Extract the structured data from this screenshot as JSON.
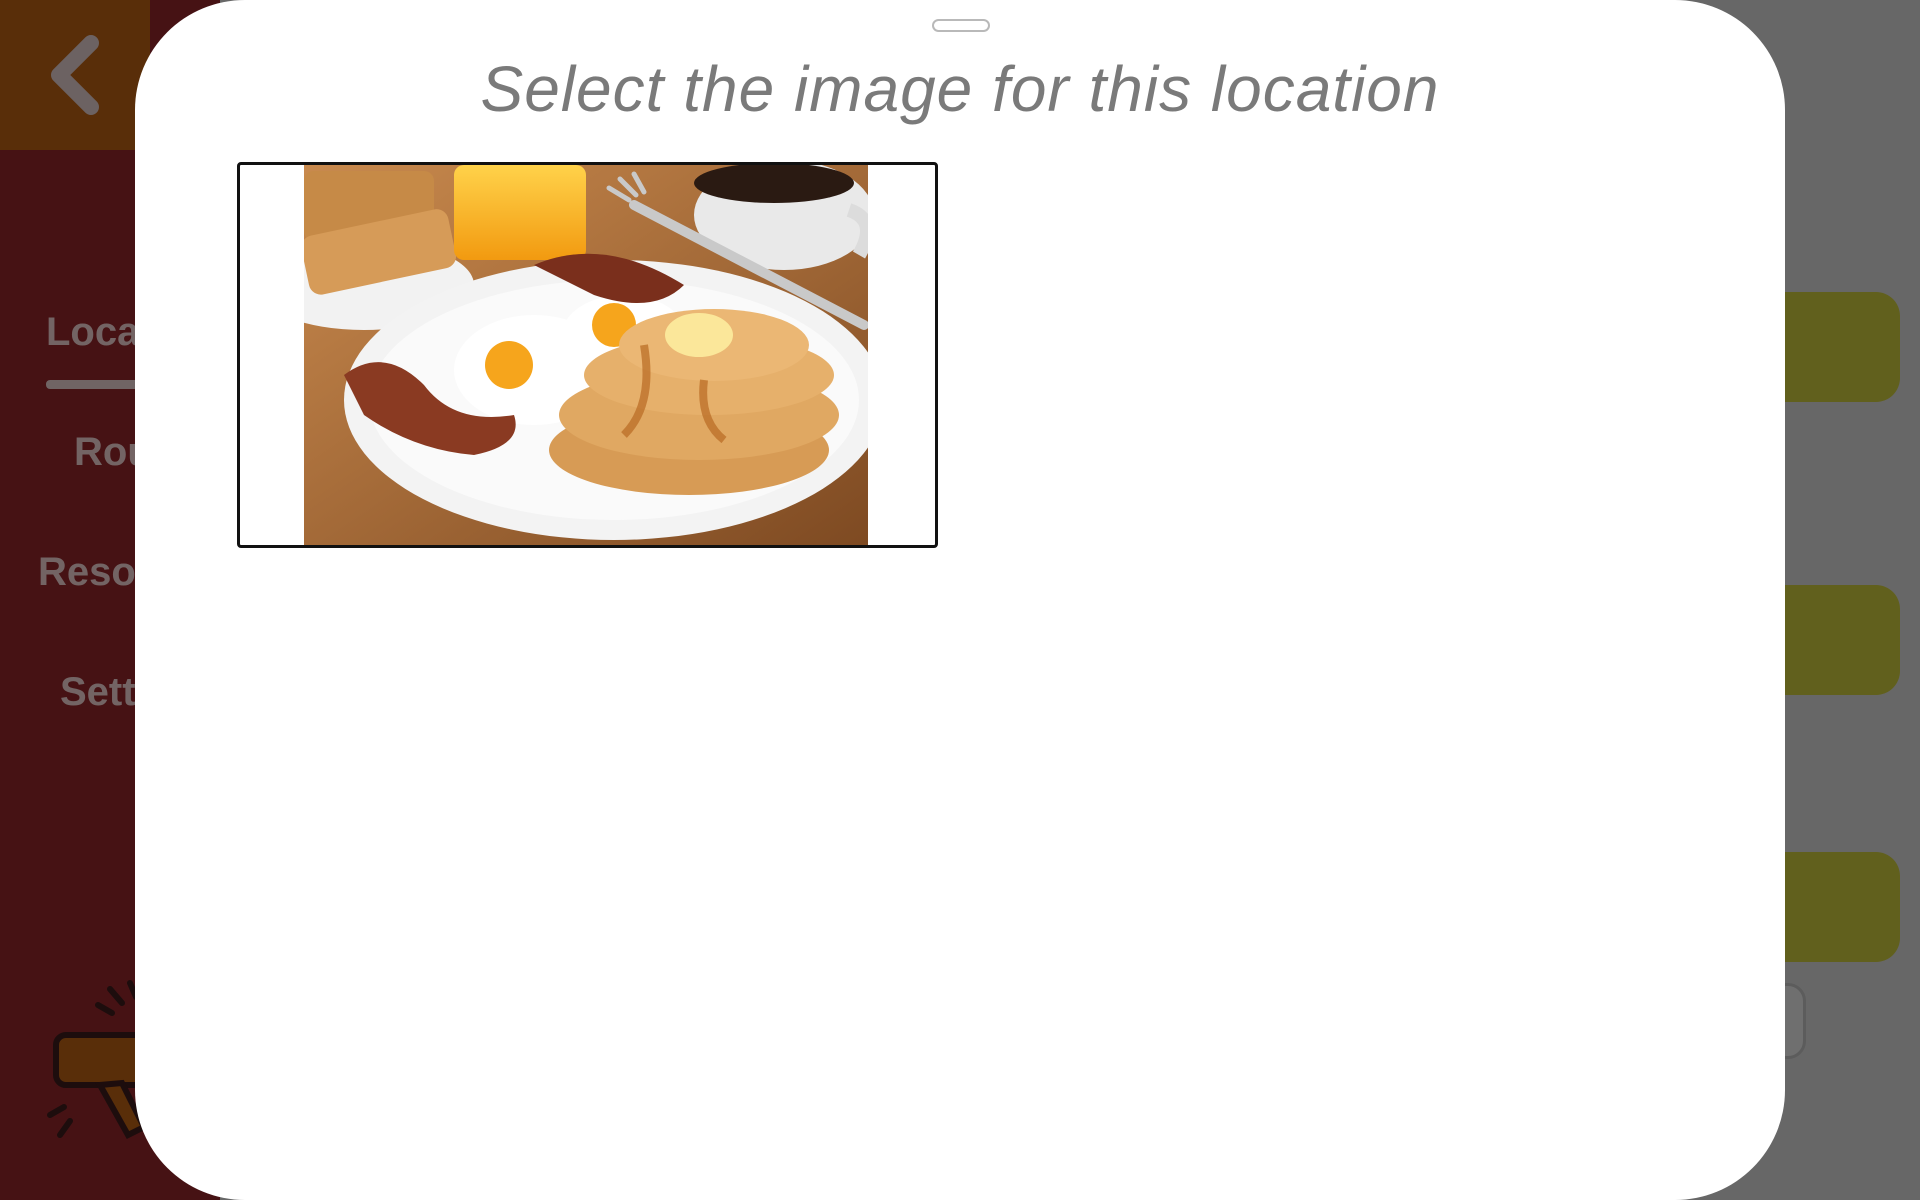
{
  "app": {
    "nav": {
      "items": [
        {
          "label": "Loca"
        },
        {
          "label": "Rou"
        },
        {
          "label": "Reso"
        },
        {
          "label": "Sett"
        }
      ]
    }
  },
  "dialog": {
    "title": "Select the image for this location",
    "images": [
      {
        "name": "breakfast-image",
        "selected": true
      }
    ]
  },
  "icons": {
    "back": "chevron-left-icon",
    "megaphone": "megaphone-icon"
  },
  "colors": {
    "sidebar": "#8c2429",
    "back_button": "#b35c12",
    "accent_cards": "#c2c13a",
    "sheet": "#ffffff",
    "title_text": "#7a7a7a"
  }
}
